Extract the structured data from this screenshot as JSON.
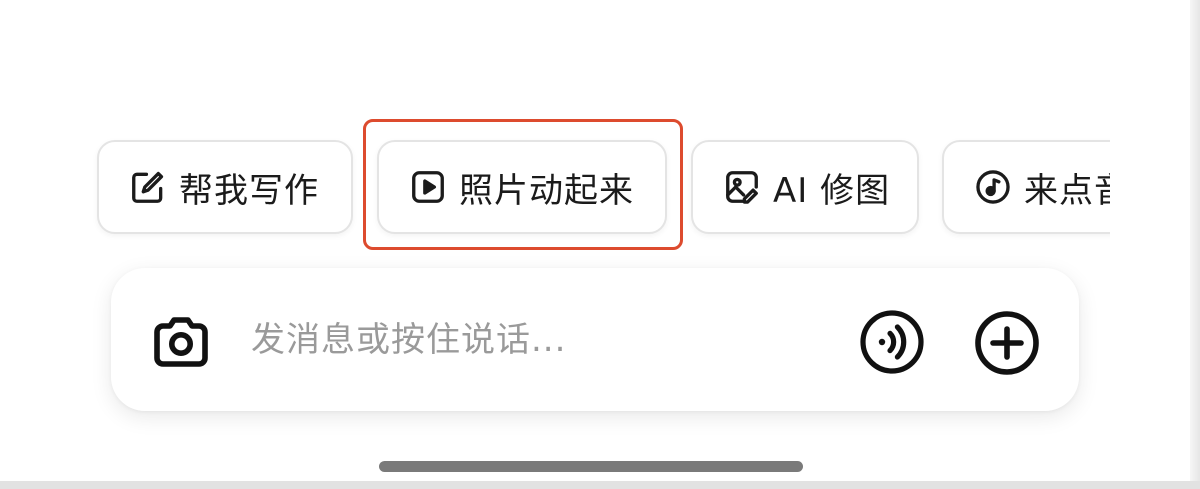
{
  "suggestions": [
    {
      "label": "帮我写作",
      "icon": "edit-icon"
    },
    {
      "label": "照片动起来",
      "icon": "play-icon"
    },
    {
      "label": "AI 修图",
      "icon": "image-edit-icon"
    },
    {
      "label": "来点音乐",
      "icon": "music-icon"
    }
  ],
  "highlighted_suggestion": "照片动起来",
  "composer": {
    "placeholder": "发消息或按住说话...",
    "value": "",
    "left_icon": "camera-icon",
    "right_icons": [
      "voice-call-icon",
      "plus-icon"
    ]
  },
  "colors": {
    "highlight": "#dd4b2e",
    "chip_border": "#e4e4e4",
    "placeholder": "#9a9a9a",
    "home_indicator": "#7a7a7a"
  }
}
